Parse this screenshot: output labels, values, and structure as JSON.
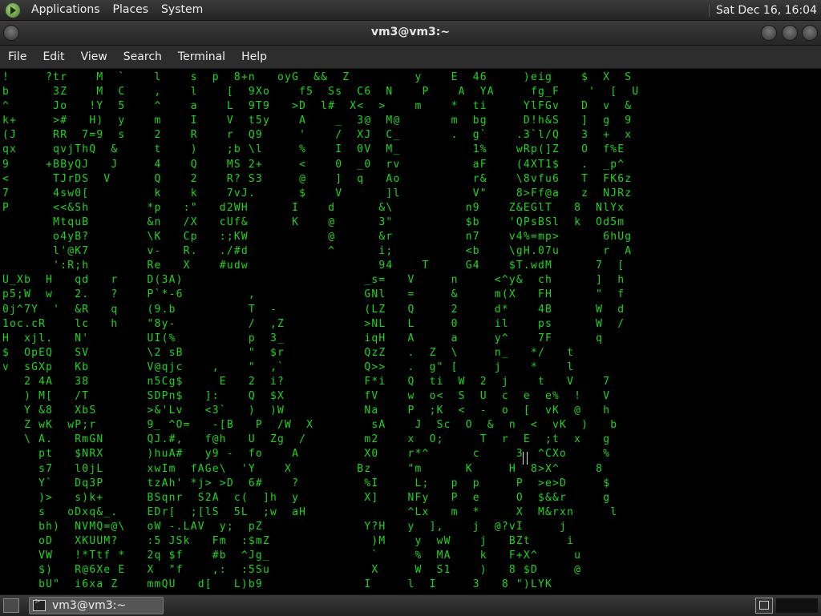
{
  "top_panel": {
    "menus": [
      "Applications",
      "Places",
      "System"
    ],
    "clock": "Sat Dec 16, 16:04"
  },
  "window": {
    "title": "vm3@vm3:~"
  },
  "menubar": {
    "items": [
      "File",
      "Edit",
      "View",
      "Search",
      "Terminal",
      "Help"
    ]
  },
  "terminal": {
    "program": "cmatrix",
    "text_color": "#1fd51f",
    "head_color": "#f2f2f2",
    "background": "#000000",
    "rain": "!     ?tr    M  `    l    s  p  8+n   oyG  &&  Z         y    E  46     )eig    $  X  S\nb      3Z    M  C    ,    l    [  9Xo    f5  Ss  C6  N    P    A  YA     fg_F    '  [  U\n^      Jo   !Y  5    ^    a    L  9T9   >D  l#  X<  >    m    *  ti     YlFGv   D  v  &\nk+     >#   H)  y    m    I    V  t5y    A    _  3@  M@       m  bg     D!h&S   ]  g  9\n(J     RR  7=9  s    2    R    r  Q9     '    /  XJ  C_       .  g`    .3`l/Q   3  +  x\nqx     qvjThQ  &     t    )    ;b \\l     %    I  0V  M_          1%    wRp(]Z   O  f%E\n9     +BByQJ   J     4    Q    MS 2+     <    0  _0  rv          aF    (4XT1$   .  _p^\n<      TJrDS  V      Q    2    R? S3     @    ]  q   Ao          r&    \\8vfu6   T  FK6z\n7      4sw0[         k    k    7vJ.      $    V      ]l          V\"    8>Ff@a   z  NJRz\nP      <<&Sh        *p   :\"   d2WH      I    d      &\\          n9    Z&EGlT   8  NlYx\n       MtquB        &n   /X   cUf&      K    @      3\"          $b    'QPsBSl  k  Od5m\n       o4yB?        \\K   Cp   :;KW           @      &r          n7    v4%=mp>      6hUg\n       l'@K7        v-   R.   ./#d           ^      i;          <b    \\gH.07u      r  A\n       ':R;h        Re   X    #udw                  94    T     G4    $T.wdM      7  [\nU_Xb  H   qd   r    D(3A)                         _s=   V     n     <^y&  ch      ]  h\np5;W  w   2.   ?    P`*-6         ,               GNl   =     &     m(X   FH      \"  f\n0j^7Y  '  &R   q    (9.b          T  -            (LZ   Q     2     d*    4B      W  d\n1oc.cR    lc   h    \"8y-          /  ,Z           >NL   L     0     il    ps      W  /\nH  xjl.   N'        UI(%          p  3_           iqH   A     a     y^    7F      q\n$  OpEQ   SV        \\2 sB         \"  $r           QzZ   .  Z  \\     n_   */   t\nv  sGXp   Kb        V@qjc    ,    \"  ,`           Q>>   .  g\" [     j    *    l\n   2 4A   38        n5Cg$     E   2  i?           F*i   Q  ti  W  2  j    t   V    7\n   ) M[   /T        SDPn$   ]:    Q  $X           fV    w  o<  S  U  c  e  e%  !   V\n   Y &8   XbS       >&'Lv   <3`   )  )W           Na    P  ;K  <  -  o  [  vK  @   h\n   Z wK  wP;r       9_ ^O=   -[B   P  /W  X        sA    J  Sc  O  &  n  <  vK  )   b\n   \\ A.   RmGN      QJ.#,   f@h   U  Zg  /        m2    x  O;     T  r  E  ;t  x   g\n     pt   $NRX      )huA#   y9 -  fo    A         X0    r*^      c     3  ^CXo     %\n     s7   l0jL      xwIm  fAGe\\  'Y    X         Bz     \"m      K     H  8>X^     8\n     Y`   Dq3P      tzAh' *j> >D  6#    ?         %I     L;   p  p     P  >e>D     $\n     )>   s)k+      BSqnr  S2A  c(  ]h  y         X]    NFy   P  e     O  $&&r     g\n     s   oDxq&_.    EDr[  ;[lS  5L  ;w  aH              ^Lx   m  *     X  M&rxn     l\n     bh)  NVMQ=@\\   oW -.LAV  y;  pZ              Y?H   y  ],    j  @?vI     j\n     oD   XKUUM?    :5 JSk   Fm  :$mZ              )M    y  wW    j   BZt     i\n     VW   !*Ttf *   2q $f    #b  ^Jg_              `     %  MA    k   F+X^     u\n     $)   R@6Xe E   X  \"f    ,:  :5Su              X     W  S1    )   8 $D     @\n     bU\"  i6xa Z    mmQU   d[   L)b9              I     l  I     3   8 \")LYK"
  },
  "taskbar": {
    "task_label": "vm3@vm3:~"
  },
  "colors": {
    "panel": "#2d2d2d",
    "matrix_green": "#1fd51f"
  }
}
